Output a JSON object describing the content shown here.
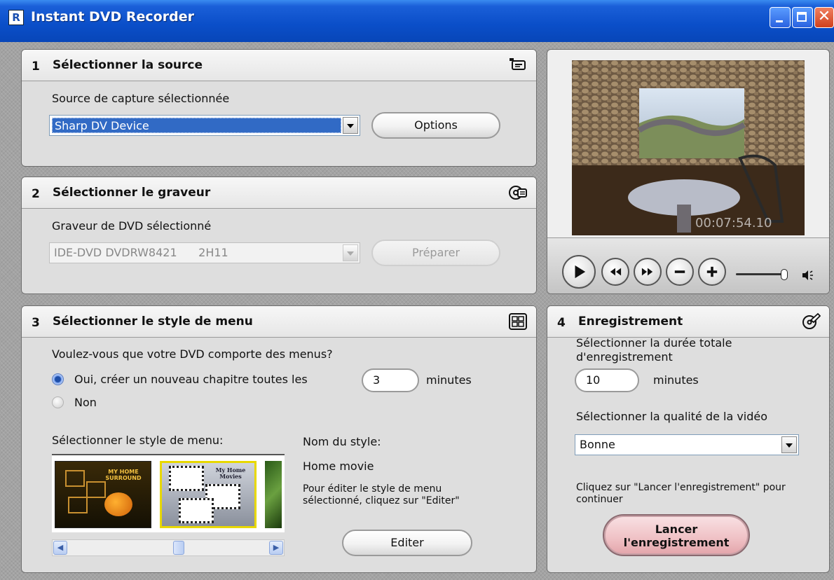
{
  "window": {
    "title": "Instant DVD Recorder",
    "app_icon_glyph": "R"
  },
  "source": {
    "number": "1",
    "title": "Sélectionner la source",
    "capture_label": "Source de capture sélectionnée",
    "selected_device": "Sharp DV Device",
    "options_label": "Options",
    "icon": "camcorder-icon"
  },
  "burner": {
    "number": "2",
    "title": "Sélectionner le graveur",
    "label": "Graveur de DVD sélectionné",
    "selected_burner": "IDE-DVD DVDRW8421      2H11",
    "prepare_label": "Préparer",
    "icon": "disc-drive-icon"
  },
  "menu": {
    "number": "3",
    "title": "Sélectionner le style de menu",
    "question": "Voulez-vous que votre DVD comporte des menus?",
    "option_yes": "Oui, créer un nouveau chapitre toutes les",
    "chapter_minutes": "3",
    "minutes_label": "minutes",
    "option_no": "Non",
    "style_list_label": "Sélectionner le style de menu:",
    "style_name_label": "Nom du style:",
    "style_name_value": "Home movie",
    "edit_hint": "Pour éditer le style de menu sélectionné, cliquez sur \"Editer\"",
    "edit_label": "Editer",
    "icon": "menu-layout-icon",
    "thumbnails": [
      {
        "caption": "MY HOME SURROUND"
      },
      {
        "caption": "My Home Movies"
      },
      {
        "caption": ""
      }
    ]
  },
  "preview": {
    "timecode": "00:07:54.10"
  },
  "recording": {
    "number": "4",
    "title": "Enregistrement",
    "duration_label": "Sélectionner la durée totale d'enregistrement",
    "duration_value": "10",
    "minutes_label": "minutes",
    "quality_label": "Sélectionner la qualité de la vidéo",
    "quality_value": "Bonne",
    "hint": "Cliquez sur \"Lancer l'enregistrement\" pour continuer",
    "record_line1": "Lancer",
    "record_line2": "l'enregistrement",
    "icon": "disc-pen-icon"
  },
  "colors": {
    "titlebar": "#0a4ec8",
    "selection": "#316ac5",
    "record_button": "#efc0c4"
  }
}
